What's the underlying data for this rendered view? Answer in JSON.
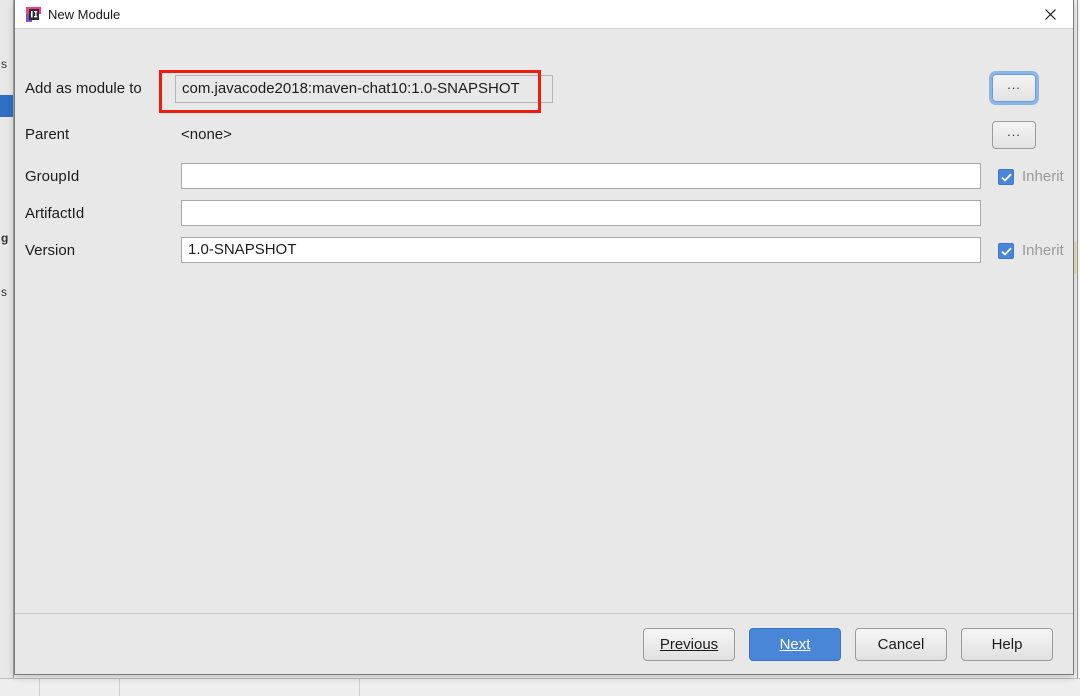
{
  "window": {
    "title": "New Module",
    "icon": "intellij-idea-icon",
    "close_label": "×"
  },
  "form": {
    "rows": [
      {
        "label": "Add as module to",
        "value": "com.javacode2018:maven-chat10:1.0-SNAPSHOT",
        "kind": "readonly",
        "browse": "...",
        "inherit": null
      },
      {
        "label": "Parent",
        "value": "<none>",
        "kind": "static",
        "browse": "...",
        "inherit": null
      },
      {
        "label": "GroupId",
        "value": "",
        "kind": "input",
        "browse": null,
        "inherit": "Inherit"
      },
      {
        "label": "ArtifactId",
        "value": "",
        "kind": "input",
        "browse": null,
        "inherit": null
      },
      {
        "label": "Version",
        "value": "1.0-SNAPSHOT",
        "kind": "input",
        "browse": null,
        "inherit": "Inherit"
      }
    ],
    "browse_button_label": "...",
    "inherit_label": "Inherit"
  },
  "footer": {
    "buttons": [
      {
        "label": "Previous",
        "mnemonic": "P",
        "default": false
      },
      {
        "label": "Next",
        "mnemonic": "N",
        "default": true
      },
      {
        "label": "Cancel",
        "mnemonic": "",
        "default": false
      },
      {
        "label": "Help",
        "mnemonic": "",
        "default": false
      }
    ]
  },
  "annotation": {
    "color": "#f01c0e",
    "target": "add-as-module-to-value"
  },
  "background": {
    "fragments": [
      "s",
      "g",
      "s"
    ]
  },
  "colors": {
    "dialog_background": "#e8e8e8",
    "titlebar_background": "#ffffff",
    "accent_blue": "#4a86d8",
    "annotation_red": "#f01c0e",
    "field_background": "#ffffff",
    "disabled_text": "#9a9a9a"
  }
}
